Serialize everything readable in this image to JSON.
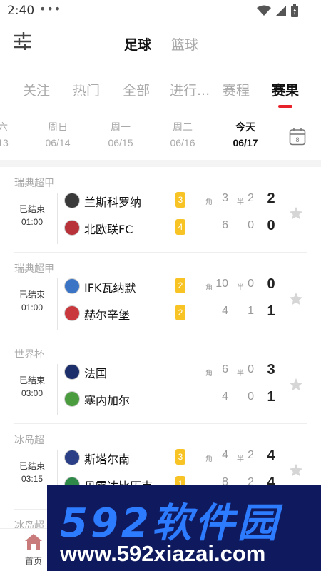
{
  "status_bar": {
    "time": "2:40",
    "dots": "•••"
  },
  "header": {
    "sport_tabs": [
      {
        "label": "足球",
        "active": true
      },
      {
        "label": "篮球",
        "active": false
      }
    ]
  },
  "category_tabs": [
    {
      "label": "关注"
    },
    {
      "label": "热门"
    },
    {
      "label": "全部"
    },
    {
      "label": "进行..."
    },
    {
      "label": "赛程"
    },
    {
      "label": "赛果",
      "active": true
    }
  ],
  "date_tabs": [
    {
      "day": "六",
      "date": "13"
    },
    {
      "day": "周日",
      "date": "06/14"
    },
    {
      "day": "周一",
      "date": "06/15"
    },
    {
      "day": "周二",
      "date": "06/16"
    },
    {
      "day": "今天",
      "date": "06/17",
      "active": true
    }
  ],
  "calendar": {
    "number": "8"
  },
  "labels": {
    "corner": "角",
    "half": "半"
  },
  "matches": [
    {
      "league": "瑞典超甲",
      "status": "已结束",
      "time": "01:00",
      "home": {
        "name": "兰斯科罗纳",
        "corners_badge": "3",
        "corners": "3",
        "half": "2",
        "score": "2",
        "logo_color": "#3a3a3a"
      },
      "away": {
        "name": "北欧联FC",
        "corners_badge": "4",
        "corners": "6",
        "half": "0",
        "score": "0",
        "logo_color": "#b8323a"
      }
    },
    {
      "league": "瑞典超甲",
      "status": "已结束",
      "time": "01:00",
      "home": {
        "name": "IFK瓦纳默",
        "corners_badge": "2",
        "corners": "10",
        "half": "0",
        "score": "0",
        "logo_color": "#3b74c4"
      },
      "away": {
        "name": "赫尔辛堡",
        "corners_badge": "2",
        "corners": "4",
        "half": "1",
        "score": "1",
        "logo_color": "#c8383d"
      }
    },
    {
      "league": "世界杯",
      "status": "已结束",
      "time": "03:00",
      "home": {
        "name": "法国",
        "corners_badge": "",
        "corners": "6",
        "half": "0",
        "score": "3",
        "logo_color": "#1d2f6b"
      },
      "away": {
        "name": "塞内加尔",
        "corners_badge": "",
        "corners": "4",
        "half": "0",
        "score": "1",
        "logo_color": "#4a9c3f"
      }
    },
    {
      "league": "冰岛超",
      "status": "已结束",
      "time": "03:15",
      "home": {
        "name": "斯塔尔南",
        "corners_badge": "3",
        "corners": "4",
        "half": "2",
        "score": "4",
        "logo_color": "#2a3f86"
      },
      "away": {
        "name": "贝雷达比历克",
        "corners_badge": "1",
        "corners": "8",
        "half": "2",
        "score": "4",
        "logo_color": "#2f8a4a"
      }
    },
    {
      "league": "冰岛超",
      "status": "",
      "time": "",
      "home": {
        "name": "",
        "corners_badge": "",
        "corners": "",
        "half": "",
        "score": "",
        "logo_color": "#ffffff"
      },
      "away": {
        "name": "",
        "corners_badge": "",
        "corners": "",
        "half": "",
        "score": "",
        "logo_color": "#ffffff"
      }
    }
  ],
  "bottom_nav": {
    "home_label": "首页"
  },
  "watermark": {
    "title": "592软件园",
    "url": "www.592xiazai.com"
  },
  "colors": {
    "accent": "#e8222b",
    "badge": "#f7c325",
    "watermark_bg": "#0f1a5e",
    "watermark_title": "#2d7bff"
  }
}
